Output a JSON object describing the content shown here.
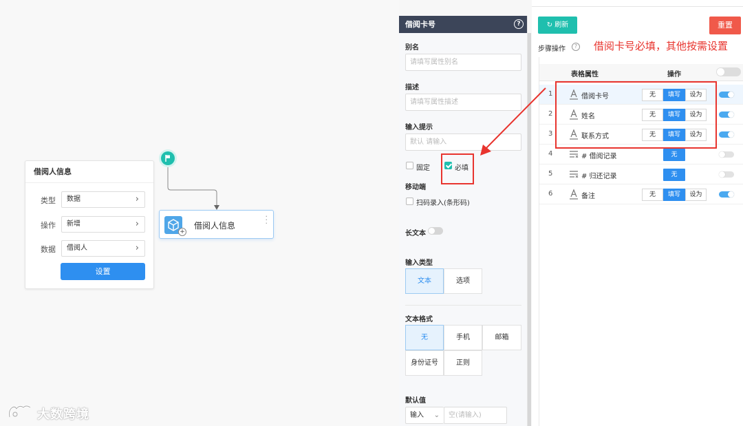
{
  "canvas": {
    "info_card": {
      "title": "借阅人信息",
      "rows": [
        {
          "label": "类型",
          "value": "数据"
        },
        {
          "label": "操作",
          "value": "新增"
        },
        {
          "label": "数据",
          "value": "借阅人"
        }
      ],
      "set_button": "设置"
    },
    "node": {
      "label": "借阅人信息"
    },
    "watermark": "大数跨境"
  },
  "panel": {
    "title": "借阅卡号",
    "help": "?",
    "alias_label": "别名",
    "alias_placeholder": "请填写属性别名",
    "desc_label": "描述",
    "desc_placeholder": "请填写属性描述",
    "hint_label": "输入提示",
    "hint_placeholder": "默认 请输入",
    "fixed_label": "固定",
    "required_label": "必填",
    "mobile_label": "移动端",
    "scan_label": "扫码录入(条形码)",
    "longtext_label": "长文本",
    "input_type_label": "输入类型",
    "input_types": [
      "文本",
      "选项"
    ],
    "text_format_label": "文本格式",
    "text_formats": [
      "无",
      "手机",
      "邮箱",
      "身份证号",
      "正则"
    ],
    "default_label": "默认值",
    "default_mode": "输入",
    "default_placeholder": "空(请输入)"
  },
  "right": {
    "refresh_label": "刷新",
    "reset_label": "重置",
    "steps_label": "步骤操作",
    "annotation": "借阅卡号必填，其他按需设置",
    "table": {
      "col_attr": "表格属性",
      "col_op": "操作",
      "rows": [
        {
          "num": "1",
          "name": "借阅卡号",
          "kind": "text",
          "ops": [
            "无",
            "填写",
            "设为"
          ],
          "active": "填写",
          "on": true
        },
        {
          "num": "2",
          "name": "姓名",
          "kind": "text",
          "ops": [
            "无",
            "填写",
            "设为"
          ],
          "active": "填写",
          "on": true
        },
        {
          "num": "3",
          "name": "联系方式",
          "kind": "text",
          "ops": [
            "无",
            "填写",
            "设为"
          ],
          "active": "填写",
          "on": true
        },
        {
          "num": "4",
          "name": "# 借阅记录",
          "kind": "list",
          "ops": [
            "无"
          ],
          "active": "无",
          "on": false
        },
        {
          "num": "5",
          "name": "# 归还记录",
          "kind": "list",
          "ops": [
            "无"
          ],
          "active": "无",
          "on": false
        },
        {
          "num": "6",
          "name": "备注",
          "kind": "text",
          "ops": [
            "无",
            "填写",
            "设为"
          ],
          "active": "填写",
          "on": true
        }
      ]
    }
  },
  "colors": {
    "primary": "#2e8ff0",
    "teal": "#1fbfae",
    "danger": "#f0594a",
    "annotation_red": "#e8342e",
    "header_dark": "#3c4559"
  }
}
